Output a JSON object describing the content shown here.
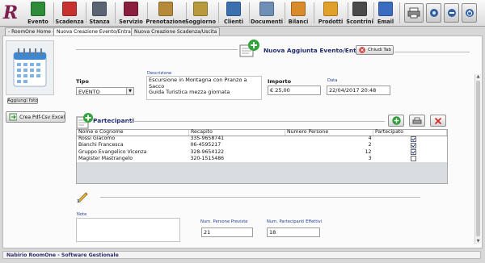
{
  "app": {
    "logo_letter": "R"
  },
  "toolbar": {
    "items": [
      {
        "label": "Evento",
        "icon": "event-flag-icon",
        "color": "#2e8b3a"
      },
      {
        "label": "Scadenza",
        "icon": "deadline-flag-icon",
        "color": "#c8322e"
      },
      {
        "label": "Stanza",
        "icon": "room-icon",
        "color": "#5a6472"
      },
      {
        "label": "Servizio",
        "icon": "service-icon",
        "color": "#8a1f3d"
      },
      {
        "label": "Prenotazione",
        "icon": "reservation-bell-icon",
        "color": "#b58a3a"
      },
      {
        "label": "Soggiorno",
        "icon": "stay-icon",
        "color": "#b79a3c"
      },
      {
        "label": "Clienti",
        "icon": "clients-icon",
        "color": "#3c6fb0"
      },
      {
        "label": "Documenti",
        "icon": "documents-icon",
        "color": "#6f8fb6"
      },
      {
        "label": "Bilanci",
        "icon": "balance-icon",
        "color": "#d98a2a"
      },
      {
        "label": "Prodotti",
        "icon": "products-icon",
        "color": "#e0a02a"
      },
      {
        "label": "Scontrini",
        "icon": "receipts-icon",
        "color": "#4b4b4b"
      },
      {
        "label": "Email",
        "icon": "email-icon",
        "color": "#3a6cc0"
      }
    ],
    "right_buttons": [
      "printer-icon",
      "settings-icon",
      "minimize-icon",
      "power-icon"
    ]
  },
  "tabs": [
    {
      "label": "- RoomOne Home -"
    },
    {
      "label": "Nuova Creazione Evento/Entrata"
    },
    {
      "label": "Nuova Creazione Scadenza/Uscita"
    }
  ],
  "side": {
    "upload_label": "Aggiungi foto",
    "export_label": "Crea Pdf-Csv Excel"
  },
  "header": {
    "title": "Nuova Aggiunta Evento/Entrata",
    "close_label": "Chiudi Tab"
  },
  "form": {
    "tipo_label": "Tipo",
    "tipo_value": "EVENTO",
    "descrizione_label": "Descrizione",
    "descrizione_lines": [
      "Escursione in Montagna con Pranzo a",
      "Sacco",
      "Guida Turistica mezza giornata"
    ],
    "importo_label": "Importo",
    "importo_value": "€ 25,00",
    "data_label": "Data",
    "data_value": "22/04/2017 20:48"
  },
  "participants": {
    "title": "Partecipanti",
    "columns": [
      "Nome e Cognome",
      "Recapito",
      "Numero Persone",
      "Partecipato"
    ],
    "rows": [
      {
        "name": "Rossi Giacomo",
        "contact": "335-9658741",
        "people": "4",
        "attended": true
      },
      {
        "name": "Bianchi Francesca",
        "contact": "06-4595217",
        "people": "2",
        "attended": true
      },
      {
        "name": "Gruppo Evangelico Vicenza",
        "contact": "328-9654122",
        "people": "12",
        "attended": true
      },
      {
        "name": "Magister Mastrangelo",
        "contact": "320-1515486",
        "people": "3",
        "attended": false
      }
    ]
  },
  "notes": {
    "label": "Note",
    "previste_label": "Num. Persone Previste",
    "previste_value": "21",
    "effettivi_label": "Num. Partecipanti Effettivi",
    "effettivi_value": "18"
  },
  "statusbar": {
    "text": "Nabirio RoomOne - Software Gestionale"
  }
}
